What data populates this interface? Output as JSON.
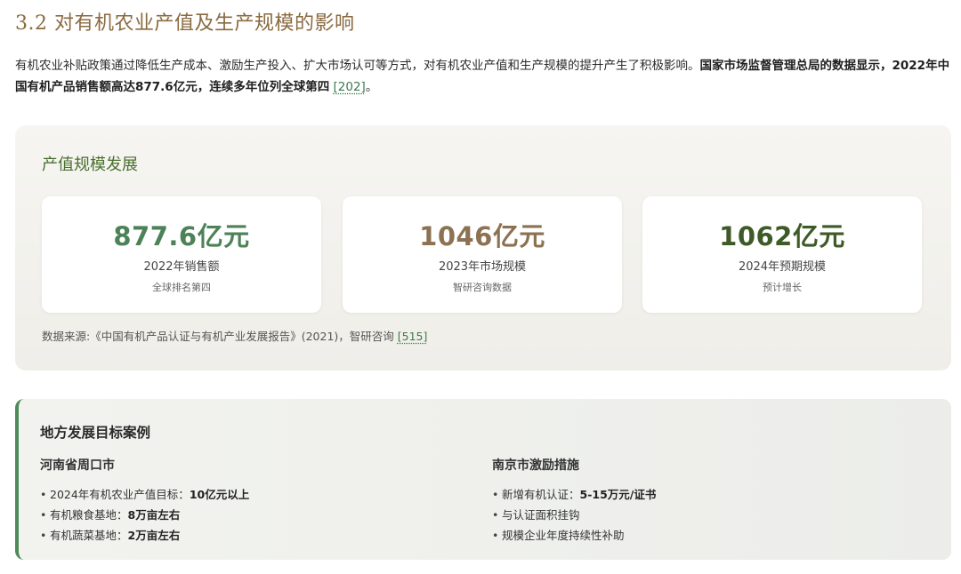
{
  "section": {
    "title": "3.2 对有机农业产值及生产规模的影响"
  },
  "intro": {
    "text": "有机农业补贴政策通过降低生产成本、激励生产投入、扩大市场认可等方式，对有机农业产值和生产规模的提升产生了积极影响。",
    "bold_text": "国家市场监督管理总局的数据显示，2022年中国有机产品销售额高达877.6亿元，连续多年位列全球第四",
    "citation": "[202]",
    "end_punct": "。"
  },
  "scale_panel": {
    "title": "产值规模发展",
    "stats": [
      {
        "value": "877.6亿元",
        "label": "2022年销售额",
        "sub": "全球排名第四",
        "color": "#4d8259"
      },
      {
        "value": "1046亿元",
        "label": "2023年市场规模",
        "sub": "智研咨询数据",
        "color": "#8c7253"
      },
      {
        "value": "1062亿元",
        "label": "2024年预期规模",
        "sub": "预计增长",
        "color": "#3e5a26"
      }
    ],
    "source_text": "数据来源:《中国有机产品认证与有机产业发展报告》(2021)，智研咨询 ",
    "source_citation": "[515]"
  },
  "case_panel": {
    "title": "地方发展目标案例",
    "left": {
      "title": "河南省周口市",
      "items": [
        {
          "text": "2024年有机农业产值目标：",
          "bold": "10亿元以上"
        },
        {
          "text": "有机粮食基地：",
          "bold": "8万亩左右"
        },
        {
          "text": "有机蔬菜基地：",
          "bold": "2万亩左右"
        }
      ]
    },
    "right": {
      "title": "南京市激励措施",
      "items": [
        {
          "text": "新增有机认证：",
          "bold": "5-15万元/证书"
        },
        {
          "text": "与认证面积挂钩",
          "bold": ""
        },
        {
          "text": "规模企业年度持续性补助",
          "bold": ""
        }
      ]
    }
  },
  "colors": {
    "title": "#8a6a3f",
    "panel_title": "#4a6f2e",
    "accent_border": "#4f8a5b",
    "citation": "#3d7a4a"
  }
}
